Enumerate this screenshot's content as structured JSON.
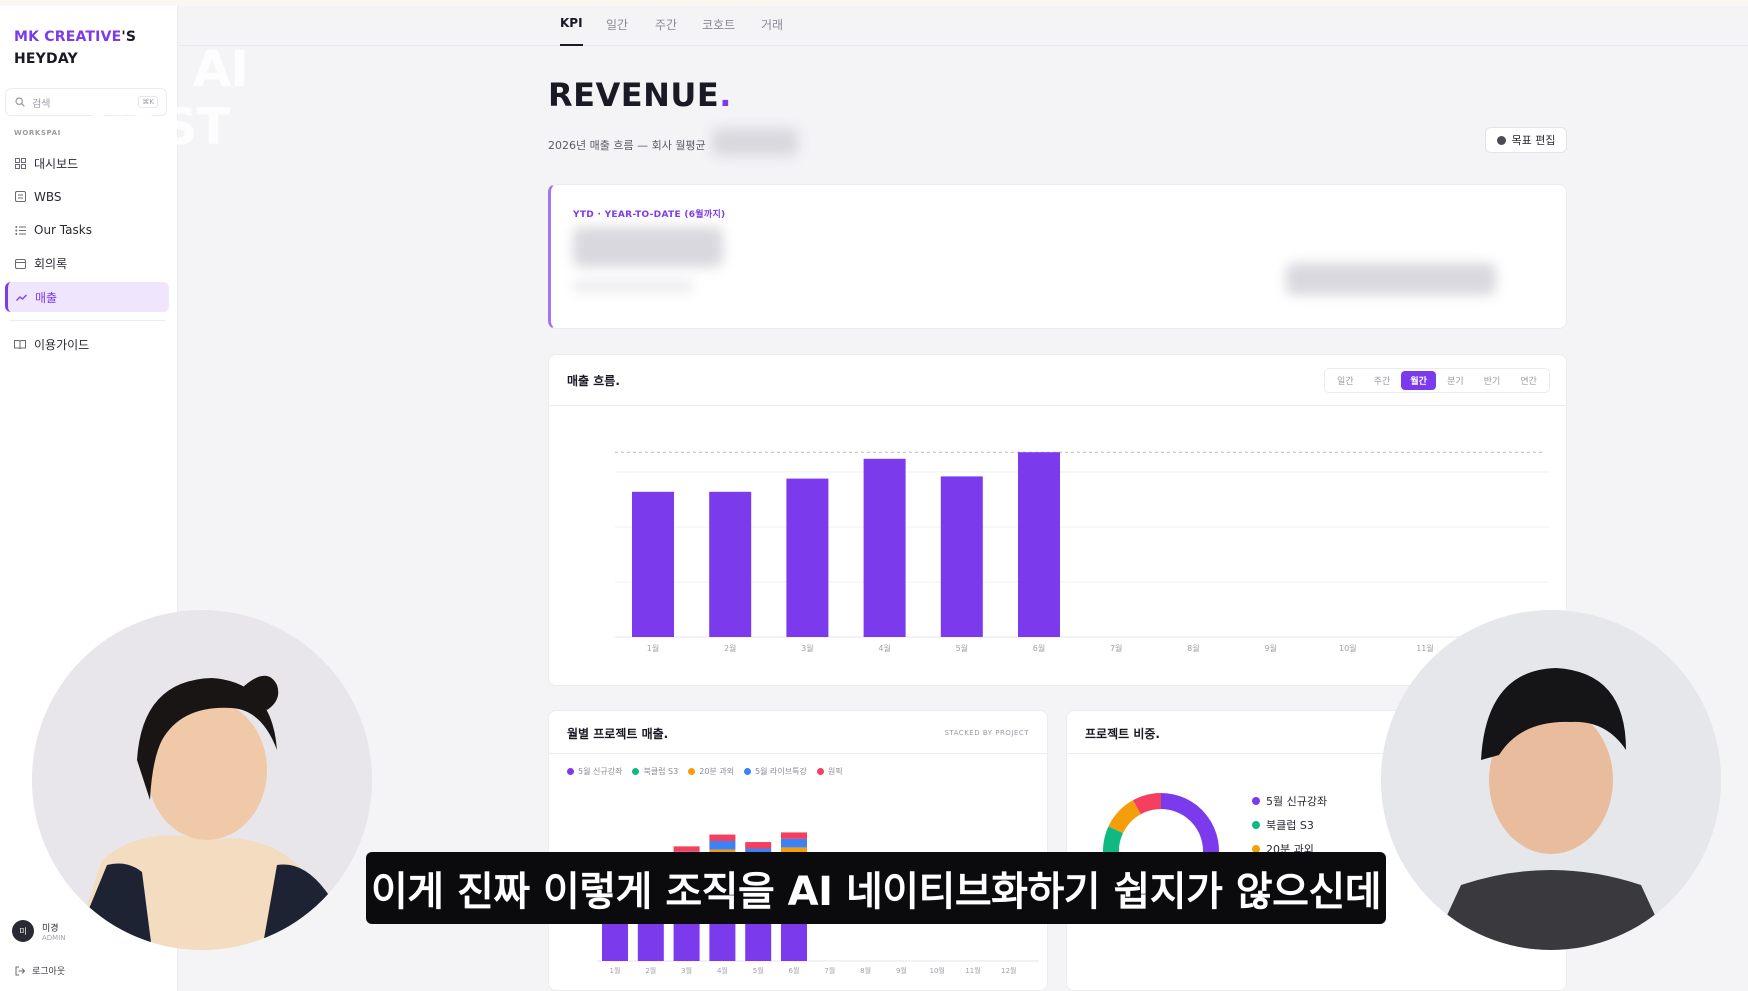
{
  "sidebar": {
    "brand_line1": "MK CREATIVE",
    "brand_apostrophe": "'S",
    "brand_line2": "HEYDAY",
    "search_placeholder": "검색",
    "search_shortcut": "⌘K",
    "workspace_label": "WORKSPAI",
    "items": [
      {
        "label": "대시보드",
        "icon": "grid-icon"
      },
      {
        "label": "WBS",
        "icon": "list-box-icon"
      },
      {
        "label": "Our Tasks",
        "icon": "checklist-icon"
      },
      {
        "label": "회의록",
        "icon": "calendar-icon"
      },
      {
        "label": "매출",
        "icon": "trend-icon",
        "active": true
      }
    ],
    "guide": {
      "label": "이용가이드",
      "icon": "book-icon"
    },
    "user": {
      "initial": "미",
      "name": "미경",
      "role": "ADMIN"
    },
    "logout": "로그아웃"
  },
  "watermark": {
    "line1": "W I AI",
    "line2": "CAST"
  },
  "tabs": [
    "KPI",
    "일간",
    "주간",
    "코호트",
    "거래"
  ],
  "active_tab": "KPI",
  "header": {
    "title": "REVENUE",
    "title_dot": ".",
    "subtitle": "2026년 매출 흐름 — 회사 월평균",
    "goal_button": "목표 편집"
  },
  "ytd": {
    "label": "YTD · YEAR-TO-DATE (6월까지)"
  },
  "revenue_card": {
    "title": "매출 흐름.",
    "periods": [
      "일간",
      "주간",
      "월간",
      "분기",
      "반기",
      "연간"
    ],
    "active_period": "월간"
  },
  "project_card": {
    "title": "월별 프로젝트 매출.",
    "stacked_label": "STACKED BY PROJECT",
    "legend": [
      {
        "name": "5월 신규강좌",
        "color": "#7c3aed"
      },
      {
        "name": "북클럽 S3",
        "color": "#10b981"
      },
      {
        "name": "20분 과외",
        "color": "#f59e0b"
      },
      {
        "name": "5월 라이브특강",
        "color": "#3b82f6"
      },
      {
        "name": "원픽",
        "color": "#f43f5e"
      }
    ]
  },
  "share_card": {
    "title": "프로젝트 비중.",
    "legend": [
      {
        "name": "5월 신규강좌",
        "color": "#7c3aed"
      },
      {
        "name": "북클럽 S3",
        "color": "#10b981"
      },
      {
        "name": "20분 과외",
        "color": "#f59e0b"
      }
    ]
  },
  "caption": "이게 진짜 이렇게 조직을 AI 네이티브화하기 쉽지가 않으신데",
  "chart_data": [
    {
      "type": "bar",
      "title": "매출 흐름.",
      "categories": [
        "1월",
        "2월",
        "3월",
        "4월",
        "5월",
        "6월",
        "7월",
        "8월",
        "9월",
        "10월",
        "11월",
        "12월"
      ],
      "values": [
        66,
        66,
        72,
        81,
        73,
        84,
        null,
        null,
        null,
        null,
        null,
        null
      ],
      "target_line": 84,
      "ylim": [
        0,
        100
      ],
      "color": "#7c3aed",
      "grid": true
    },
    {
      "type": "bar",
      "title": "월별 프로젝트 매출.",
      "stacked": true,
      "categories": [
        "1월",
        "2월",
        "3월",
        "4월",
        "5월",
        "6월",
        "7월",
        "8월",
        "9월",
        "10월",
        "11월",
        "12월"
      ],
      "series": [
        {
          "name": "5월 신규강좌",
          "values": [
            90,
            88,
            95,
            100,
            95,
            100,
            0,
            0,
            0,
            0,
            0,
            0
          ]
        },
        {
          "name": "북클럽 S3",
          "values": [
            0,
            0,
            0,
            0,
            0,
            0,
            0,
            0,
            0,
            0,
            0,
            0
          ]
        },
        {
          "name": "20분 과외",
          "values": [
            0,
            0,
            3,
            4,
            4,
            6,
            0,
            0,
            0,
            0,
            0,
            0
          ]
        },
        {
          "name": "5월 라이브특강",
          "values": [
            0,
            0,
            4,
            8,
            6,
            8,
            0,
            0,
            0,
            0,
            0,
            0
          ]
        },
        {
          "name": "원픽",
          "values": [
            5,
            5,
            5,
            6,
            6,
            6,
            0,
            0,
            0,
            0,
            0,
            0
          ]
        }
      ],
      "ylim": [
        0,
        140
      ]
    },
    {
      "type": "pie",
      "title": "프로젝트 비중.",
      "categories": [
        "5월 신규강좌",
        "북클럽 S3",
        "20분 과외",
        "원픽"
      ],
      "values": [
        58,
        24,
        10,
        8
      ]
    }
  ]
}
